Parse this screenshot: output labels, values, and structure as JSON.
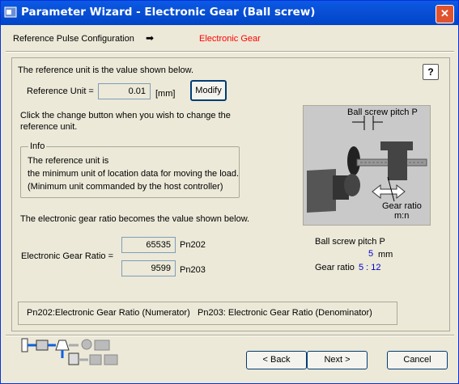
{
  "window": {
    "title": "Parameter Wizard - Electronic Gear (Ball screw)",
    "close": "✕"
  },
  "breadcrumb": {
    "step1": "Reference Pulse Configuration",
    "arrow": "➡",
    "step2": "Electronic Gear",
    "step2_color": "#ff0000"
  },
  "reference": {
    "intro": "The reference unit is the value shown below.",
    "label": "Reference Unit =",
    "value": "0.01",
    "unit": "[mm]",
    "modify_label": "Modify",
    "change_line1": "Click the change button when you wish to change the",
    "change_line2": "reference unit."
  },
  "info": {
    "legend": "Info",
    "line1": "The reference unit is",
    "line2": "the minimum unit of location data for moving the load.",
    "line3": "(Minimum unit commanded by the host controller)"
  },
  "diagram": {
    "pitch_label": "Ball screw pitch P",
    "gear_label1": "Gear ratio",
    "gear_label2": "m:n"
  },
  "gear": {
    "intro": "The electronic gear ratio becomes the value shown below.",
    "label": "Electronic Gear Ratio =",
    "numerator": "65535",
    "numerator_param": "Pn202",
    "denominator": "9599",
    "denominator_param": "Pn203"
  },
  "summary": {
    "pitch_title": "Ball screw pitch P",
    "pitch_value": "5",
    "pitch_unit": "mm",
    "ratio_title": "Gear ratio",
    "ratio_value": "5 : 12"
  },
  "note": {
    "numerator_desc": "Pn202:Electronic Gear Ratio (Numerator)",
    "denominator_desc": "Pn203: Electronic Gear Ratio (Denominator)"
  },
  "buttons": {
    "back": "< Back",
    "next": "Next >",
    "cancel": "Cancel"
  }
}
